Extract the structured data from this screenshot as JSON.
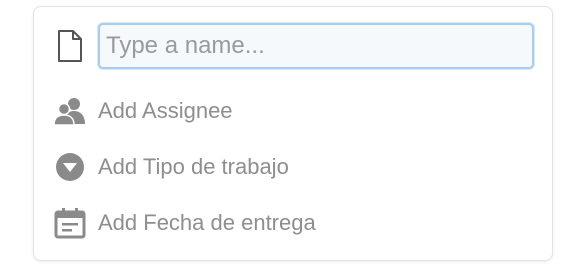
{
  "new_item": {
    "name_placeholder": "Type a name...",
    "name_value": "",
    "actions": [
      {
        "label": "Add Assignee",
        "icon": "people-icon"
      },
      {
        "label": "Add Tipo de trabajo",
        "icon": "dropdown-circle-icon"
      },
      {
        "label": "Add Fecha de entrega",
        "icon": "calendar-icon"
      }
    ]
  },
  "colors": {
    "icon_gray": "#8a8a8a",
    "input_focus_border": "#a9cdec",
    "label_gray": "#8e8e8e"
  }
}
